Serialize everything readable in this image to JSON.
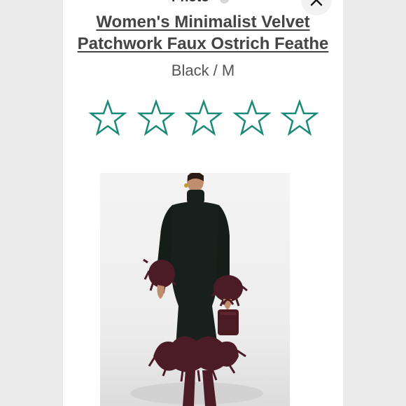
{
  "header": {
    "label": "Photo",
    "close_icon": "close-icon"
  },
  "product": {
    "title_line1": "Women's Minimalist Velvet",
    "title_line2": "Patchwork Faux Ostrich Feathe",
    "variant": "Black / M"
  },
  "rating": {
    "selected": 0,
    "max": 5,
    "star_color": "#1a8a78"
  },
  "photo": {
    "icon": "product-photo",
    "dress_color": "#17201c",
    "feather_color": "#4b1b26"
  }
}
